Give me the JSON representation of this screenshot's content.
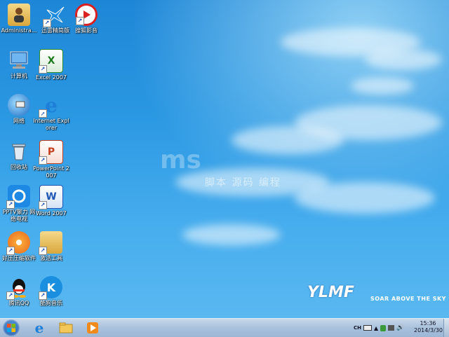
{
  "desktop_icons": [
    {
      "label": "Administra...",
      "icon": "user-folder-icon"
    },
    {
      "label": "迅雷精简版",
      "icon": "xunlei-icon"
    },
    {
      "label": "搜狐影音",
      "icon": "sohu-video-icon"
    },
    {
      "label": "计算机",
      "icon": "computer-icon"
    },
    {
      "label": "Excel 2007",
      "icon": "excel-icon"
    },
    {
      "label": "网络",
      "icon": "network-icon"
    },
    {
      "label": "Internet Explorer",
      "icon": "internet-explorer-icon"
    },
    {
      "label": "回收站",
      "icon": "recycle-bin-icon"
    },
    {
      "label": "PowerPoint 2007",
      "icon": "powerpoint-icon"
    },
    {
      "label": "PPTV聚力 网络电视",
      "icon": "pptv-icon"
    },
    {
      "label": "Word 2007",
      "icon": "word-icon"
    },
    {
      "label": "好压压缩软件",
      "icon": "haozip-icon"
    },
    {
      "label": "激活工具",
      "icon": "activation-tool-icon"
    },
    {
      "label": "腾讯QQ",
      "icon": "qq-icon"
    },
    {
      "label": "酷狗音乐",
      "icon": "kugou-icon"
    }
  ],
  "watermark": {
    "text": "脚本 源码 编程",
    "big": "ms"
  },
  "logo": {
    "brand": "YLMF",
    "slogan": "SOAR ABOVE THE SKY"
  },
  "taskbar": {
    "pinned": [
      {
        "icon": "internet-explorer-icon"
      },
      {
        "icon": "folder-icon"
      },
      {
        "icon": "media-player-icon"
      }
    ],
    "tray": {
      "lang": "CH"
    },
    "clock": {
      "time": "15:36",
      "date": "2014/3/30"
    }
  }
}
